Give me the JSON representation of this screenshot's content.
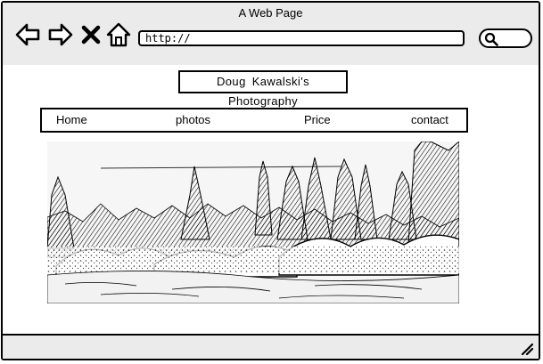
{
  "window": {
    "title": "A Web Page"
  },
  "toolbar": {
    "back_icon": "back-arrow-icon",
    "forward_icon": "forward-arrow-icon",
    "stop_icon": "close-x-icon",
    "home_icon": "home-icon",
    "url_value": "http://",
    "search_icon": "search-icon"
  },
  "page": {
    "site_title": "Doug  Kawalski's  Photography",
    "menu": [
      {
        "label": "Home"
      },
      {
        "label": "photos"
      },
      {
        "label": "Price"
      },
      {
        "label": "contact"
      }
    ],
    "hero_image": "winter forest landscape photo"
  },
  "status_bar": {
    "resize_icon": "resize-grip-icon"
  }
}
